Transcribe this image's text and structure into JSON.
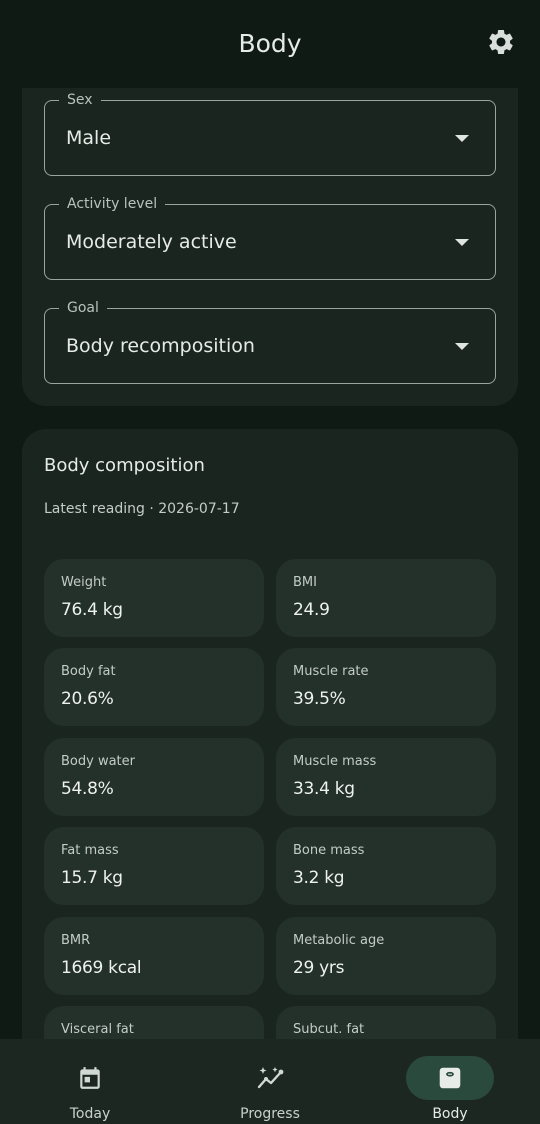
{
  "app_bar": {
    "title": "Body",
    "settings_icon": "gear-icon"
  },
  "profile": {
    "fields": [
      {
        "label": "Sex",
        "value": "Male"
      },
      {
        "label": "Activity level",
        "value": "Moderately active"
      },
      {
        "label": "Goal",
        "value": "Body recomposition"
      }
    ]
  },
  "composition": {
    "title": "Body composition",
    "subtitle": "Latest reading · 2026-07-17",
    "metrics": [
      {
        "label": "Weight",
        "value": "76.4 kg"
      },
      {
        "label": "BMI",
        "value": "24.9"
      },
      {
        "label": "Body fat",
        "value": "20.6%"
      },
      {
        "label": "Muscle rate",
        "value": "39.5%"
      },
      {
        "label": "Body water",
        "value": "54.8%"
      },
      {
        "label": "Muscle mass",
        "value": "33.4 kg"
      },
      {
        "label": "Fat mass",
        "value": "15.7 kg"
      },
      {
        "label": "Bone mass",
        "value": "3.2 kg"
      },
      {
        "label": "BMR",
        "value": "1669 kcal"
      },
      {
        "label": "Metabolic age",
        "value": "29 yrs"
      },
      {
        "label": "Visceral fat",
        "value": ""
      },
      {
        "label": "Subcut. fat",
        "value": ""
      }
    ]
  },
  "bottom_nav": {
    "items": [
      {
        "label": "Today",
        "icon": "calendar-icon",
        "active": false
      },
      {
        "label": "Progress",
        "icon": "trend-icon",
        "active": false
      },
      {
        "label": "Body",
        "icon": "scale-icon",
        "active": true
      }
    ]
  },
  "colors": {
    "background": "#0f1a15",
    "card": "#1a2520",
    "metric_tile": "#24302a",
    "nav_active_pill": "#2b4a3e"
  }
}
